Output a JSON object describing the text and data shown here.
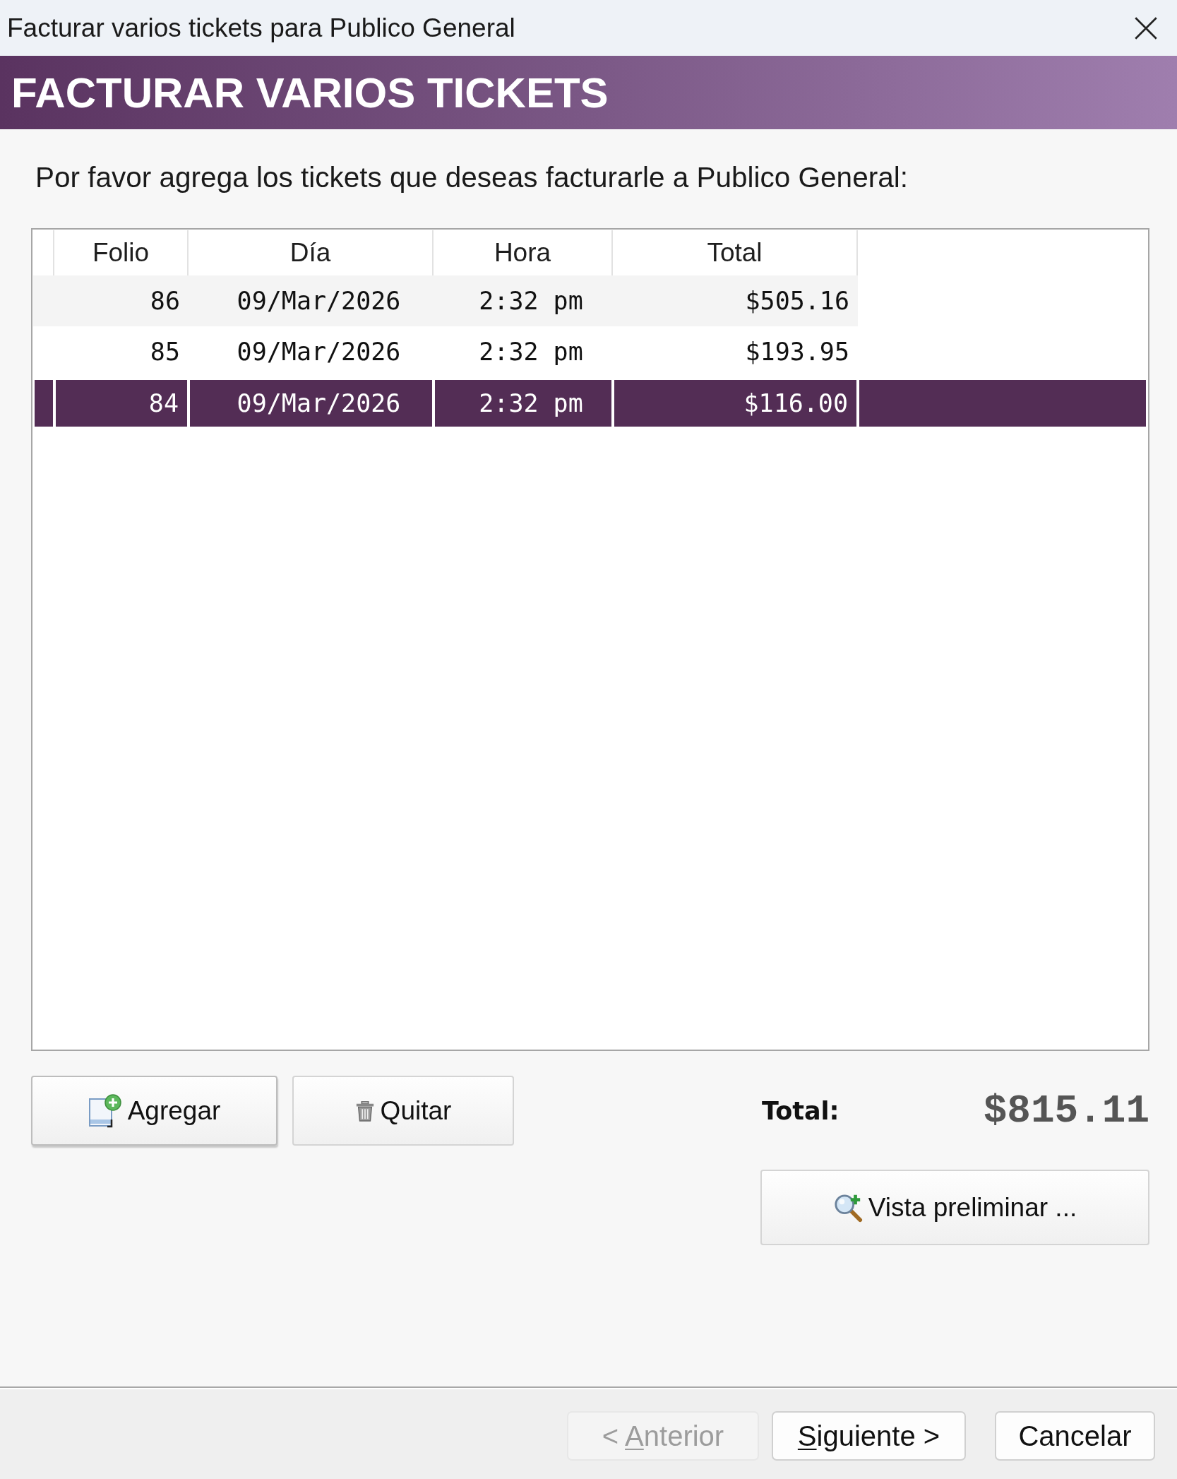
{
  "window": {
    "title": "Facturar varios tickets para Publico General"
  },
  "banner": {
    "title": "FACTURAR VARIOS TICKETS"
  },
  "instructions": "Por favor agrega los tickets que deseas facturarle a Publico General:",
  "table": {
    "columns": [
      "Folio",
      "Día",
      "Hora",
      "Total"
    ],
    "rows": [
      {
        "cells": [
          "86",
          "09/Mar/2026",
          "2:32 pm",
          "$505.16"
        ],
        "selected": false
      },
      {
        "cells": [
          "85",
          "09/Mar/2026",
          "2:32 pm",
          "$193.95"
        ],
        "selected": false
      },
      {
        "cells": [
          "84",
          "09/Mar/2026",
          "2:32 pm",
          "$116.00"
        ],
        "selected": true
      }
    ]
  },
  "actions": [
    {
      "kind": "add",
      "label": "Agregar",
      "focused": true
    },
    {
      "kind": "remove",
      "label": "Quitar",
      "focused": false
    }
  ],
  "total": {
    "label": "Total:",
    "value": "$815.11"
  },
  "preview_button": {
    "label": "Vista preliminar ..."
  },
  "footer": {
    "buttons": [
      {
        "label_before": "< ",
        "access_key": "A",
        "label_after": "nterior",
        "disabled": true
      },
      {
        "access_key": "S",
        "label_after": "iguiente >",
        "disabled": false
      },
      {
        "label": "Cancelar",
        "disabled": false
      }
    ]
  }
}
